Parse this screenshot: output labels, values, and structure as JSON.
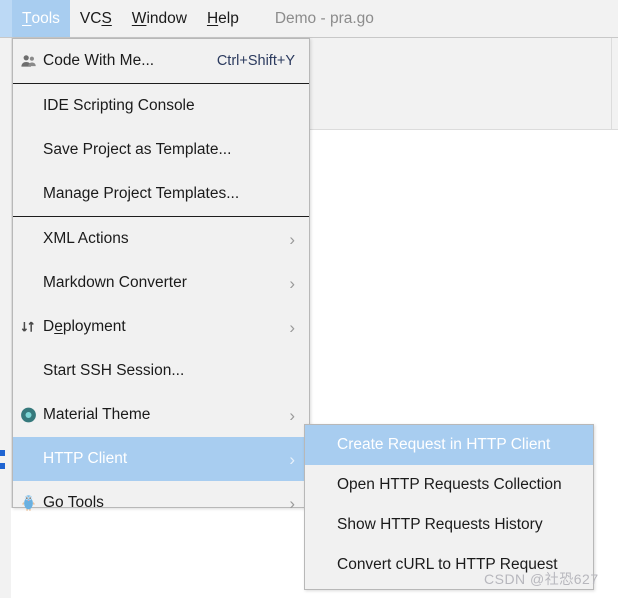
{
  "colors": {
    "menu_bg": "#f1f1f1",
    "menu_border": "#b8b8b8",
    "highlight": "#a8cdf0",
    "highlight_text": "#ffffff",
    "text": "#1b1b1b",
    "shortcut_text": "#2b3a5e",
    "title_text": "#8c8c8c",
    "toolbar_bg": "#f2f2f2",
    "separator": "#1d1d1d",
    "material_theme_accent": "#3f8f8f",
    "gopher_blue": "#6ab0e0",
    "watermark": "#b7b7bd",
    "gutter_marker": "#1e64d2"
  },
  "menubar": {
    "items": [
      {
        "label": "Tools",
        "mnemonic": "T",
        "selected": true
      },
      {
        "label": "VCS",
        "mnemonic": "S",
        "selected": false
      },
      {
        "label": "Window",
        "mnemonic": "W",
        "selected": false
      },
      {
        "label": "Help",
        "mnemonic": "H",
        "selected": false
      }
    ],
    "window_title": "Demo - pra.go"
  },
  "tools_menu": {
    "items": [
      {
        "label": "Code With Me...",
        "shortcut": "Ctrl+Shift+Y",
        "icon": "code-with-me-icon",
        "submenu": false,
        "highlighted": false
      },
      {
        "separator": true
      },
      {
        "label": "IDE Scripting Console",
        "shortcut": "",
        "icon": "",
        "submenu": false,
        "highlighted": false
      },
      {
        "label": "Save Project as Template...",
        "shortcut": "",
        "icon": "",
        "submenu": false,
        "highlighted": false
      },
      {
        "label": "Manage Project Templates...",
        "shortcut": "",
        "icon": "",
        "submenu": false,
        "highlighted": false
      },
      {
        "separator": true
      },
      {
        "label": "XML Actions",
        "shortcut": "",
        "icon": "",
        "submenu": true,
        "highlighted": false
      },
      {
        "label": "Markdown Converter",
        "shortcut": "",
        "icon": "",
        "submenu": true,
        "highlighted": false
      },
      {
        "label": "Deployment",
        "mnemonic": "e",
        "shortcut": "",
        "icon": "deployment-icon",
        "submenu": true,
        "highlighted": false
      },
      {
        "label": "Start SSH Session...",
        "shortcut": "",
        "icon": "",
        "submenu": false,
        "highlighted": false
      },
      {
        "label": "Material Theme",
        "shortcut": "",
        "icon": "material-theme-icon",
        "submenu": true,
        "highlighted": false
      },
      {
        "label": "HTTP Client",
        "shortcut": "",
        "icon": "",
        "submenu": true,
        "highlighted": true
      },
      {
        "label": "Go Tools",
        "shortcut": "",
        "icon": "go-gopher-icon",
        "submenu": true,
        "highlighted": false
      }
    ]
  },
  "http_client_submenu": {
    "items": [
      {
        "label": "Create Request in HTTP Client",
        "highlighted": true
      },
      {
        "label": "Open HTTP Requests Collection",
        "highlighted": false
      },
      {
        "label": "Show HTTP Requests History",
        "highlighted": false
      },
      {
        "label": "Convert cURL to HTTP Request",
        "highlighted": false
      }
    ]
  },
  "watermark": {
    "text": "CSDN @社恐627"
  }
}
